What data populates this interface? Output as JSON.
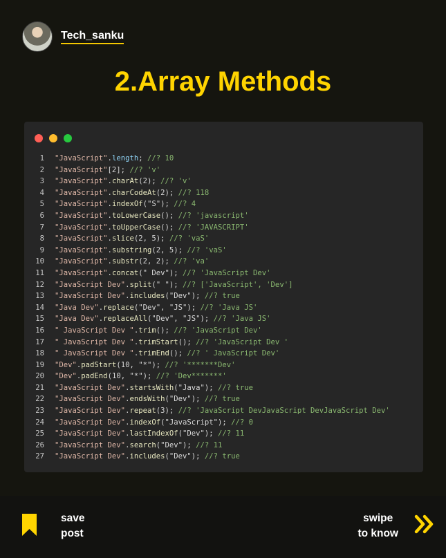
{
  "profile": {
    "username": "Tech_sanku"
  },
  "title": "2.Array Methods",
  "code_lines": [
    {
      "n": "1",
      "parts": [
        [
          "str",
          "\"JavaScript\""
        ],
        [
          "punc",
          "."
        ],
        [
          "prop",
          "length"
        ],
        [
          "punc",
          "; "
        ],
        [
          "comment",
          "//? 10"
        ]
      ]
    },
    {
      "n": "2",
      "parts": [
        [
          "str",
          "\"JavaScript\""
        ],
        [
          "punc",
          "[2]; "
        ],
        [
          "comment",
          "//? 'v'"
        ]
      ]
    },
    {
      "n": "3",
      "parts": [
        [
          "str",
          "\"JavaScript\""
        ],
        [
          "punc",
          "."
        ],
        [
          "method",
          "charAt"
        ],
        [
          "punc",
          "(2); "
        ],
        [
          "comment",
          "//? 'v'"
        ]
      ]
    },
    {
      "n": "4",
      "parts": [
        [
          "str",
          "\"JavaScript\""
        ],
        [
          "punc",
          "."
        ],
        [
          "method",
          "charCodeAt"
        ],
        [
          "punc",
          "(2); "
        ],
        [
          "comment",
          "//? 118"
        ]
      ]
    },
    {
      "n": "5",
      "parts": [
        [
          "str",
          "\"JavaScript\""
        ],
        [
          "punc",
          "."
        ],
        [
          "method",
          "indexOf"
        ],
        [
          "punc",
          "(\"S\"); "
        ],
        [
          "comment",
          "//? 4"
        ]
      ]
    },
    {
      "n": "6",
      "parts": [
        [
          "str",
          "\"JavaScript\""
        ],
        [
          "punc",
          "."
        ],
        [
          "method",
          "toLowerCase"
        ],
        [
          "punc",
          "(); "
        ],
        [
          "comment",
          "//? 'javascript'"
        ]
      ]
    },
    {
      "n": "7",
      "parts": [
        [
          "str",
          "\"JavaScript\""
        ],
        [
          "punc",
          "."
        ],
        [
          "method",
          "toUpperCase"
        ],
        [
          "punc",
          "(); "
        ],
        [
          "comment",
          "//? 'JAVASCRIPT'"
        ]
      ]
    },
    {
      "n": "8",
      "parts": [
        [
          "str",
          "\"JavaScript\""
        ],
        [
          "punc",
          "."
        ],
        [
          "method",
          "slice"
        ],
        [
          "punc",
          "(2, 5); "
        ],
        [
          "comment",
          "//? 'vaS'"
        ]
      ]
    },
    {
      "n": "9",
      "parts": [
        [
          "str",
          "\"JavaScript\""
        ],
        [
          "punc",
          "."
        ],
        [
          "method",
          "substring"
        ],
        [
          "punc",
          "(2, 5); "
        ],
        [
          "comment",
          "//? 'vaS'"
        ]
      ]
    },
    {
      "n": "10",
      "parts": [
        [
          "str",
          "\"JavaScript\""
        ],
        [
          "punc",
          "."
        ],
        [
          "method",
          "substr"
        ],
        [
          "punc",
          "(2, 2); "
        ],
        [
          "comment",
          "//? 'va'"
        ]
      ]
    },
    {
      "n": "11",
      "parts": [
        [
          "str",
          "\"JavaScript\""
        ],
        [
          "punc",
          "."
        ],
        [
          "method",
          "concat"
        ],
        [
          "punc",
          "(\" Dev\"); "
        ],
        [
          "comment",
          "//? 'JavaScript Dev'"
        ]
      ]
    },
    {
      "n": "12",
      "parts": [
        [
          "str",
          "\"JavaScript Dev\""
        ],
        [
          "punc",
          "."
        ],
        [
          "method",
          "split"
        ],
        [
          "punc",
          "(\" \"); "
        ],
        [
          "comment",
          "//? ['JavaScript', 'Dev']"
        ]
      ]
    },
    {
      "n": "13",
      "parts": [
        [
          "str",
          "\"JavaScript Dev\""
        ],
        [
          "punc",
          "."
        ],
        [
          "method",
          "includes"
        ],
        [
          "punc",
          "(\"Dev\"); "
        ],
        [
          "comment",
          "//? true"
        ]
      ]
    },
    {
      "n": "14",
      "parts": [
        [
          "str",
          "\"Java Dev\""
        ],
        [
          "punc",
          "."
        ],
        [
          "method",
          "replace"
        ],
        [
          "punc",
          "(\"Dev\", \"JS\"); "
        ],
        [
          "comment",
          "//? 'Java JS'"
        ]
      ]
    },
    {
      "n": "15",
      "parts": [
        [
          "str",
          "\"Java Dev\""
        ],
        [
          "punc",
          "."
        ],
        [
          "method",
          "replaceAll"
        ],
        [
          "punc",
          "(\"Dev\", \"JS\"); "
        ],
        [
          "comment",
          "//? 'Java JS'"
        ]
      ]
    },
    {
      "n": "16",
      "parts": [
        [
          "str",
          "\" JavaScript Dev \""
        ],
        [
          "punc",
          "."
        ],
        [
          "method",
          "trim"
        ],
        [
          "punc",
          "(); "
        ],
        [
          "comment",
          "//? 'JavaScript Dev'"
        ]
      ]
    },
    {
      "n": "17",
      "parts": [
        [
          "str",
          "\" JavaScript Dev \""
        ],
        [
          "punc",
          "."
        ],
        [
          "method",
          "trimStart"
        ],
        [
          "punc",
          "(); "
        ],
        [
          "comment",
          "//? 'JavaScript Dev '"
        ]
      ]
    },
    {
      "n": "18",
      "parts": [
        [
          "str",
          "\" JavaScript Dev \""
        ],
        [
          "punc",
          "."
        ],
        [
          "method",
          "trimEnd"
        ],
        [
          "punc",
          "(); "
        ],
        [
          "comment",
          "//? ' JavaScript Dev'"
        ]
      ]
    },
    {
      "n": "19",
      "parts": [
        [
          "str",
          "\"Dev\""
        ],
        [
          "punc",
          "."
        ],
        [
          "method",
          "padStart"
        ],
        [
          "punc",
          "(10, \"*\"); "
        ],
        [
          "comment",
          "//? '*******Dev'"
        ]
      ]
    },
    {
      "n": "20",
      "parts": [
        [
          "str",
          "\"Dev\""
        ],
        [
          "punc",
          "."
        ],
        [
          "method",
          "padEnd"
        ],
        [
          "punc",
          "(10, \"*\"); "
        ],
        [
          "comment",
          "//? 'Dev*******'"
        ]
      ]
    },
    {
      "n": "21",
      "parts": [
        [
          "str",
          "\"JavaScript Dev\""
        ],
        [
          "punc",
          "."
        ],
        [
          "method",
          "startsWith"
        ],
        [
          "punc",
          "(\"Java\"); "
        ],
        [
          "comment",
          "//? true"
        ]
      ]
    },
    {
      "n": "22",
      "parts": [
        [
          "str",
          "\"JavaScript Dev\""
        ],
        [
          "punc",
          "."
        ],
        [
          "method",
          "endsWith"
        ],
        [
          "punc",
          "(\"Dev\"); "
        ],
        [
          "comment",
          "//? true"
        ]
      ]
    },
    {
      "n": "23",
      "parts": [
        [
          "str",
          "\"JavaScript Dev\""
        ],
        [
          "punc",
          "."
        ],
        [
          "method",
          "repeat"
        ],
        [
          "punc",
          "(3); "
        ],
        [
          "comment",
          "//? 'JavaScript DevJavaScript DevJavaScript Dev'"
        ]
      ]
    },
    {
      "n": "24",
      "parts": [
        [
          "str",
          "\"JavaScript Dev\""
        ],
        [
          "punc",
          "."
        ],
        [
          "method",
          "indexOf"
        ],
        [
          "punc",
          "(\"JavaScript\"); "
        ],
        [
          "comment",
          "//? 0"
        ]
      ]
    },
    {
      "n": "25",
      "parts": [
        [
          "str",
          "\"JavaScript Dev\""
        ],
        [
          "punc",
          "."
        ],
        [
          "method",
          "lastIndexOf"
        ],
        [
          "punc",
          "(\"Dev\"); "
        ],
        [
          "comment",
          "//? 11"
        ]
      ]
    },
    {
      "n": "26",
      "parts": [
        [
          "str",
          "\"JavaScript Dev\""
        ],
        [
          "punc",
          "."
        ],
        [
          "method",
          "search"
        ],
        [
          "punc",
          "(\"Dev\"); "
        ],
        [
          "comment",
          "//? 11"
        ]
      ]
    },
    {
      "n": "27",
      "parts": [
        [
          "str",
          "\"JavaScript Dev\""
        ],
        [
          "punc",
          "."
        ],
        [
          "method",
          "includes"
        ],
        [
          "punc",
          "(\"Dev\"); "
        ],
        [
          "comment",
          "//? true"
        ]
      ]
    }
  ],
  "footer": {
    "save_line1": "save",
    "save_line2": "post",
    "swipe_line1": "swipe",
    "swipe_line2": "to know",
    "bookmark_icon": "bookmark-icon",
    "chevron_icon": "double-chevron-right-icon",
    "accent_color": "#ffd400"
  }
}
